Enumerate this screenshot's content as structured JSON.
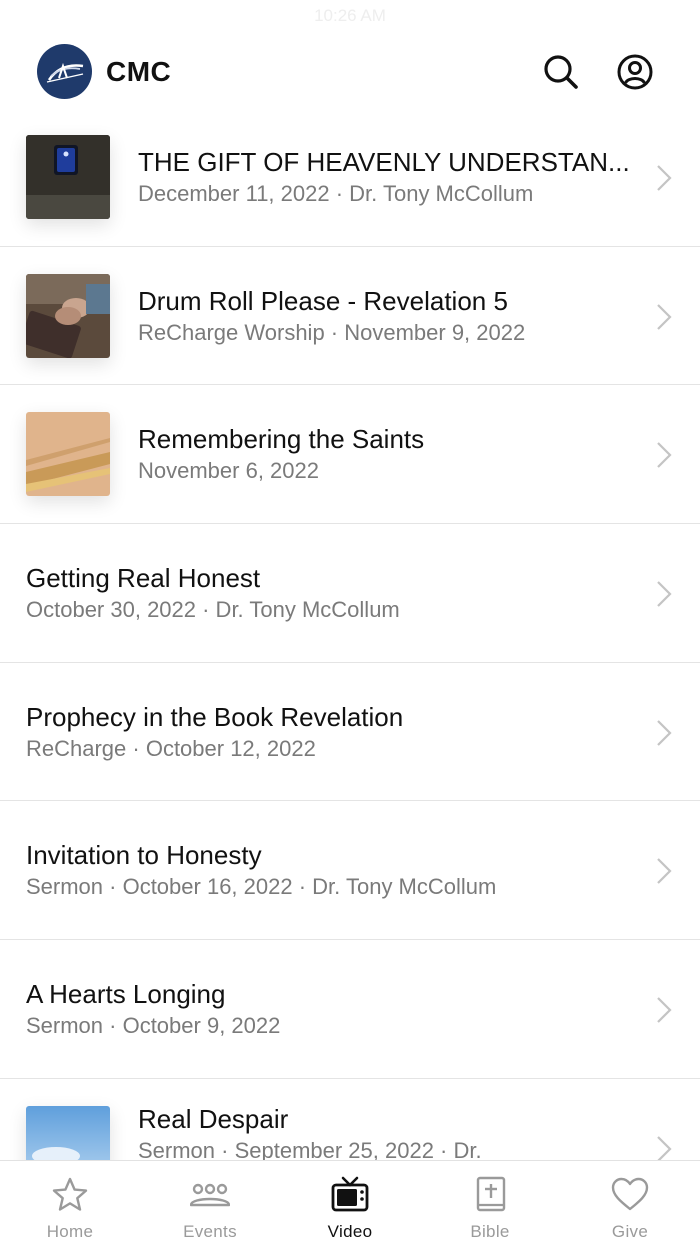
{
  "status_bar": {
    "time": "10:26 AM"
  },
  "header": {
    "title": "CMC"
  },
  "videos": [
    {
      "title": "THE GIFT OF HEAVENLY UNDERSTAN...",
      "subtitle": "December 11, 2022 · Dr. Tony McCollum",
      "thumbnail": "dark-window"
    },
    {
      "title": "Drum Roll Please - Revelation 5",
      "subtitle": "ReCharge Worship · November 9, 2022",
      "thumbnail": "praying-hands-bible"
    },
    {
      "title": "Remembering the Saints",
      "subtitle": "November 6, 2022",
      "thumbnail": "gold-abstract"
    },
    {
      "title": "Getting Real Honest",
      "subtitle": "October 30, 2022 · Dr. Tony McCollum",
      "thumbnail": null
    },
    {
      "title": "Prophecy in the Book Revelation",
      "subtitle": "ReCharge · October 12, 2022",
      "thumbnail": null
    },
    {
      "title": "Invitation to Honesty",
      "subtitle": "Sermon · October 16, 2022 · Dr. Tony McCollum",
      "thumbnail": null
    },
    {
      "title": "A Hearts Longing",
      "subtitle": "Sermon · October 9, 2022",
      "thumbnail": null
    },
    {
      "title": "Real Despair",
      "subtitle": "Sermon · September 25, 2022 · Dr.",
      "thumbnail": "sky"
    }
  ],
  "tabs": [
    {
      "label": "Home",
      "icon": "star-icon",
      "active": false
    },
    {
      "label": "Events",
      "icon": "people-icon",
      "active": false
    },
    {
      "label": "Video",
      "icon": "tv-icon",
      "active": true
    },
    {
      "label": "Bible",
      "icon": "bible-icon",
      "active": false
    },
    {
      "label": "Give",
      "icon": "heart-icon",
      "active": false
    }
  ],
  "colors": {
    "brand": "#1f3a6b",
    "active": "#111111",
    "inactive": "#9a9a9a",
    "divider": "#e4e4e4"
  }
}
